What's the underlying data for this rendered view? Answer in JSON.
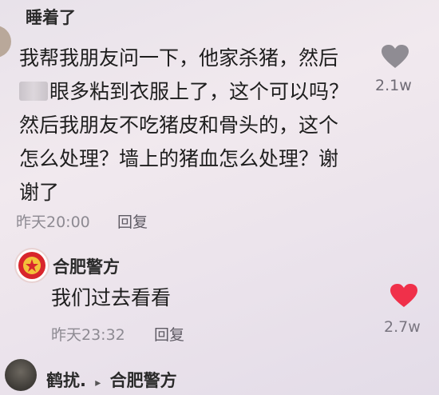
{
  "comment1": {
    "username": "睡着了",
    "lines": [
      "我帮我朋友问一下，他家杀猪，然后",
      "眼多粘到衣服上了，这个可以吗？",
      "然后我朋友不吃猪皮和骨头的，这个",
      "怎么处理？墙上的猪血怎么处理？谢",
      "谢了"
    ],
    "time": "昨天20:00",
    "reply_label": "回复",
    "like_count": "2.1w",
    "liked": false
  },
  "comment2": {
    "username": "合肥警方",
    "text": "我们过去看看",
    "time": "昨天23:32",
    "reply_label": "回复",
    "like_count": "2.7w",
    "liked": true
  },
  "comment3": {
    "username": "鹤扰.",
    "reply_arrow": "▸",
    "reply_to": "合肥警方"
  },
  "colors": {
    "heart_gray": "#8f8c93",
    "heart_red": "#f0304a",
    "police_red": "#d8262c"
  }
}
